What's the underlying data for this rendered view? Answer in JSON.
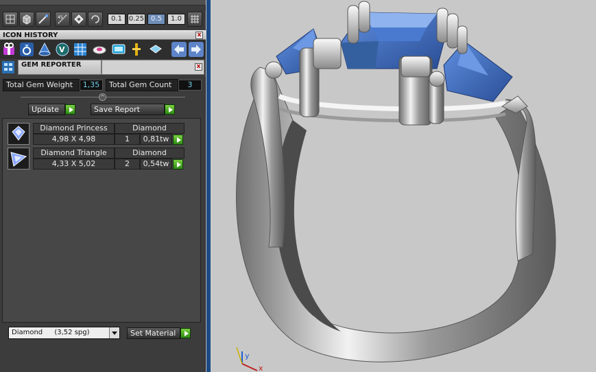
{
  "toolbar": {
    "zoom_values": [
      "0.1",
      "0.25",
      "0.5",
      "1.0"
    ],
    "active_zoom_index": 2
  },
  "icon_history": {
    "title": "ICON HISTORY",
    "close_label": "x",
    "icons": [
      "gift-box-icon",
      "ring-icon",
      "cone-icon",
      "v-sphere-icon",
      "grid-icon",
      "gem-dish-icon",
      "monitor-icon",
      "pin-icon",
      "gem-icon",
      "arrow-left-icon",
      "arrow-right-icon"
    ]
  },
  "gem_reporter": {
    "title": "GEM REPORTER",
    "close_label": "x",
    "total_weight_label": "Total Gem Weight",
    "total_weight_value": "1,35",
    "total_count_label": "Total Gem Count",
    "total_count_value": "3",
    "update_label": "Update",
    "save_label": "Save Report",
    "gems": [
      {
        "name": "Diamond Princess",
        "material": "Diamond",
        "size": "4,98 X 4,98",
        "count": "1",
        "weight": "0,81tw"
      },
      {
        "name": "Diamond Triangle",
        "material": "Diamond",
        "size": "4,33 X 5,02",
        "count": "2",
        "weight": "0,54tw"
      }
    ],
    "material_select": {
      "name": "Diamond",
      "density": "(3,52 spg)"
    },
    "set_material_label": "Set Material"
  },
  "viewport": {
    "axis_y_label": "y",
    "axis_x_label": "x",
    "colors": {
      "metal": "#b8b8b8",
      "gem": "#3f69b4",
      "background": "#c8c8c8",
      "border": "#1c4a85"
    }
  }
}
